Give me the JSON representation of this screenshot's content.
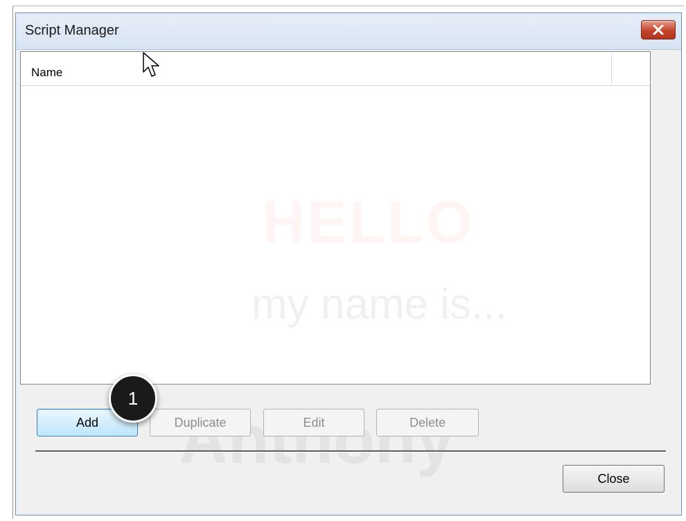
{
  "window": {
    "title": "Script Manager"
  },
  "listview": {
    "columns": [
      "Name"
    ],
    "rows": []
  },
  "watermark": {
    "line1": "HELLO",
    "line2": "my name is...",
    "line3": "Anthony"
  },
  "buttons": {
    "add": "Add",
    "duplicate": "Duplicate",
    "edit": "Edit",
    "delete": "Delete",
    "close": "Close"
  },
  "callout": {
    "number": "1"
  },
  "icons": {
    "close": "close-icon",
    "cursor": "mouse-pointer-icon"
  },
  "colors": {
    "title_close_red": "#c4442a",
    "default_button_blue": "#bee6fd"
  }
}
